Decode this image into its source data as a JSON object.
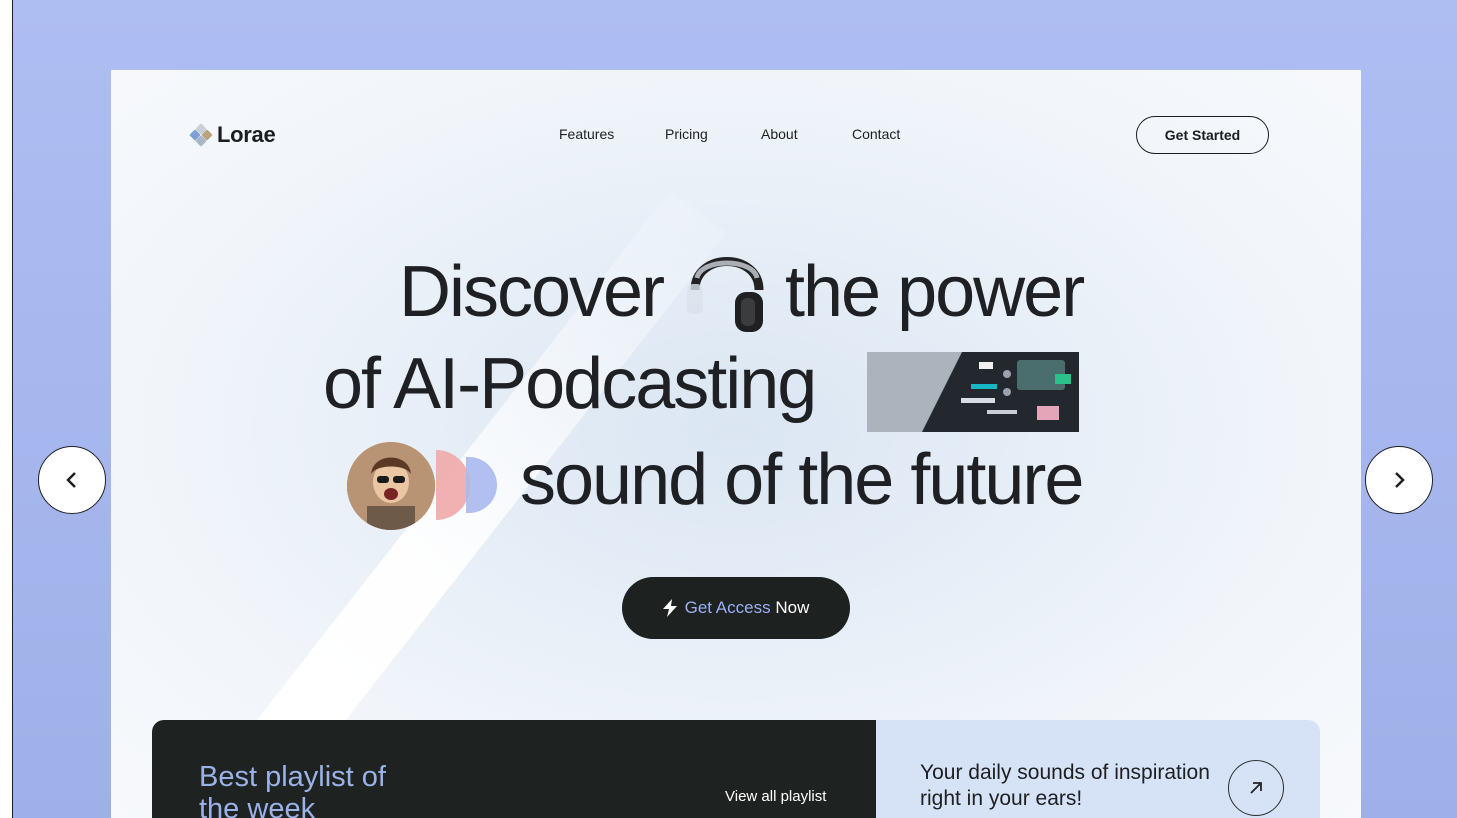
{
  "brand": {
    "name": "Lorae",
    "logo_colors": [
      "#c9cfd6",
      "#b9a47c",
      "#7fa0d6",
      "#a9b7c4"
    ]
  },
  "nav": {
    "items": [
      "Features",
      "Pricing",
      "About",
      "Contact"
    ],
    "cta_label": "Get Started"
  },
  "hero": {
    "line1_a": "Discover",
    "line1_b": "the power",
    "line2": "of AI-Podcasting",
    "line3": "sound of the future",
    "cta_accent": "Get Access",
    "cta_rest": "Now"
  },
  "cards": {
    "playlist_title": "Best playlist of the week",
    "playlist_link": "View all playlist",
    "daily_text": "Your daily sounds of inspiration right in your ears!"
  },
  "icons": {
    "cta": "lightning-icon",
    "card": "arrow-up-right-icon",
    "prev": "chevron-left-icon",
    "next": "chevron-right-icon"
  },
  "colors": {
    "background": "#a9b9f0",
    "dark": "#1e2321",
    "accent": "#9ab0f4",
    "card_light": "#d6e3f6"
  }
}
